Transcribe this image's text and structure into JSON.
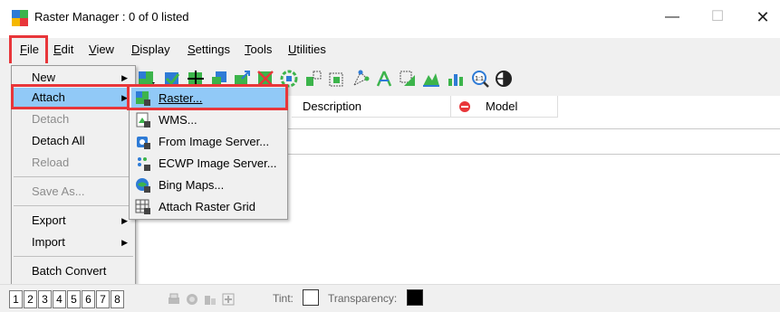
{
  "window": {
    "title": "Raster Manager : 0 of 0 listed",
    "minimize_glyph": "—",
    "maximize_glyph": "☐",
    "close_glyph": "✕",
    "app_icon": "raster-manager-icon"
  },
  "menubar": {
    "items": [
      {
        "key": "F",
        "rest": "ile"
      },
      {
        "key": "E",
        "rest": "dit"
      },
      {
        "key": "V",
        "rest": "iew"
      },
      {
        "key": "D",
        "rest": "isplay"
      },
      {
        "key": "S",
        "rest": "ettings"
      },
      {
        "key": "T",
        "rest": "ools"
      },
      {
        "key": "U",
        "rest": "tilities"
      }
    ]
  },
  "file_menu": {
    "items": [
      {
        "label": "New",
        "disabled": false,
        "submenu": true
      },
      {
        "label": "Attach",
        "disabled": false,
        "submenu": true,
        "selected": true
      },
      {
        "label": "Detach",
        "disabled": true
      },
      {
        "label": "Detach All",
        "disabled": false
      },
      {
        "label": "Reload",
        "disabled": true
      },
      {
        "label": "Save As...",
        "disabled": true
      },
      {
        "label": "Export",
        "disabled": false,
        "submenu": true
      },
      {
        "label": "Import",
        "disabled": false,
        "submenu": true
      },
      {
        "label": "Batch Convert",
        "disabled": false
      }
    ]
  },
  "attach_submenu": {
    "items": [
      {
        "label": "Raster...",
        "icon": "raster-attach-icon",
        "selected": true
      },
      {
        "label": "WMS...",
        "icon": "wms-icon"
      },
      {
        "label": "From Image Server...",
        "icon": "image-server-icon"
      },
      {
        "label": "ECWP Image Server...",
        "icon": "ecwp-server-icon"
      },
      {
        "label": "Bing Maps...",
        "icon": "bing-maps-icon"
      },
      {
        "label": "Attach Raster Grid",
        "icon": "raster-grid-icon"
      }
    ]
  },
  "columns": {
    "description": "Description",
    "model": "Model"
  },
  "statusbar": {
    "view_numbers": [
      "1",
      "2",
      "3",
      "4",
      "5",
      "6",
      "7",
      "8"
    ],
    "tint_label": "Tint:",
    "transparency_label": "Transparency:"
  },
  "colors": {
    "highlight_border": "#e8363a",
    "selection": "#91c9f7",
    "menu_bg": "#f0f0f0"
  }
}
